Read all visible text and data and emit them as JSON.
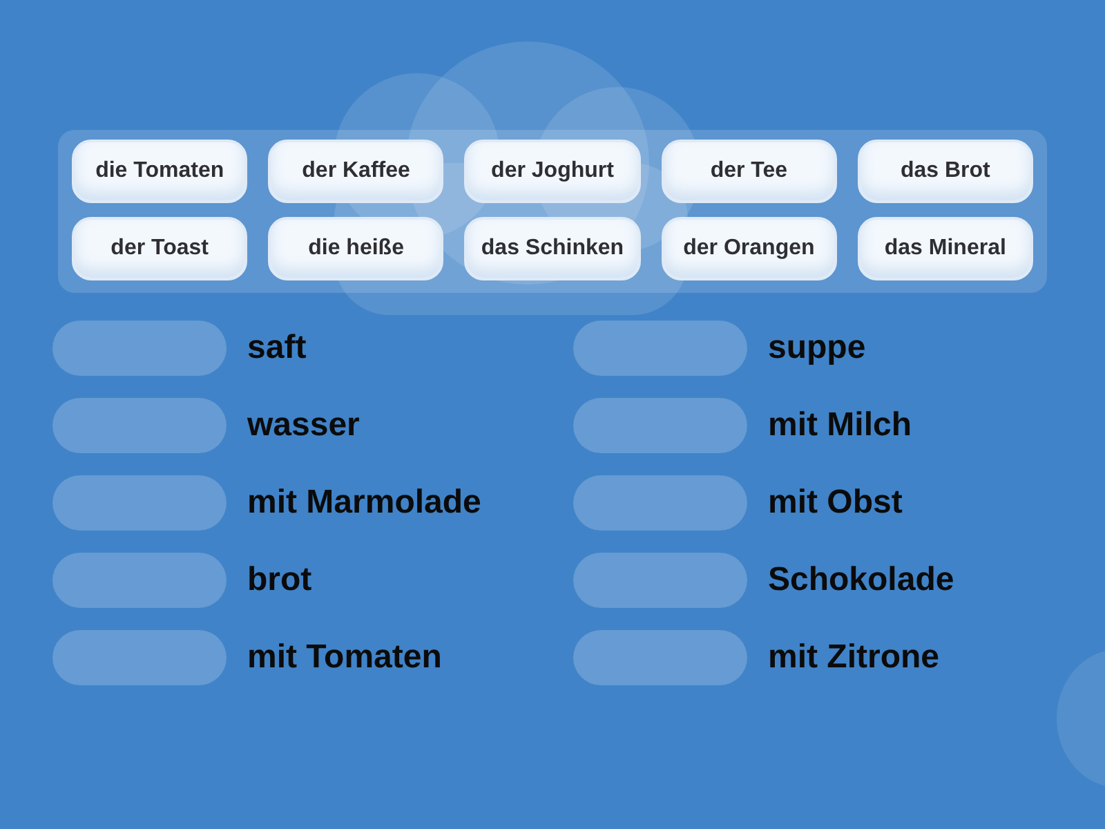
{
  "word_bank": {
    "tiles": [
      "die Tomaten",
      "der Kaffee",
      "der Joghurt",
      "der Tee",
      "das Brot",
      "der Toast",
      "die heiße",
      "das Schinken",
      "der Orangen",
      "das Mineral"
    ]
  },
  "left_column": [
    {
      "text": "saft"
    },
    {
      "text": "wasser"
    },
    {
      "text": "mit Marmolade"
    },
    {
      "text": "brot"
    },
    {
      "text": "mit Tomaten"
    }
  ],
  "right_column": [
    {
      "text": "suppe"
    },
    {
      "text": "mit Milch"
    },
    {
      "text": "mit Obst"
    },
    {
      "text": "Schokolade"
    },
    {
      "text": "mit Zitrone"
    }
  ]
}
